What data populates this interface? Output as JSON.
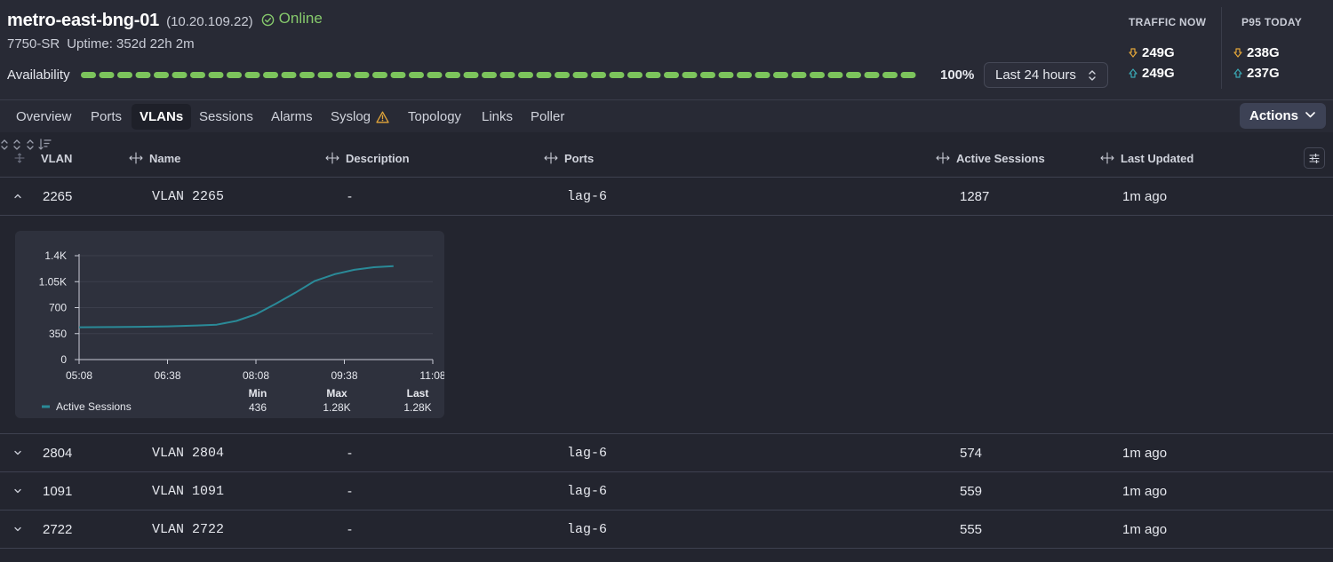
{
  "device": {
    "name": "metro-east-bng-01",
    "ip": "(10.20.109.22)",
    "status": "Online",
    "status_color": "#86c96c",
    "model": "7750-SR",
    "uptime": "Uptime: 352d 22h 2m",
    "availability_label": "Availability",
    "availability_pct": "100%",
    "availability_value": 1.0,
    "availability_color": "#7cc45c",
    "time_range": "Last 24 hours"
  },
  "traffic_now": {
    "label": "TRAFFIC NOW",
    "in": "249G",
    "out": "249G"
  },
  "p95_today": {
    "label": "P95 TODAY",
    "in": "238G",
    "out": "237G"
  },
  "colors": {
    "in_arrow": "#e3a63a",
    "out_arrow": "#3aa8b4",
    "warning": "#e3a63a",
    "series": "#2a8a98"
  },
  "tabs": [
    {
      "label": "Overview",
      "active": false
    },
    {
      "label": "Ports",
      "active": false
    },
    {
      "label": "VLANs",
      "active": true
    },
    {
      "label": "Sessions",
      "active": false
    },
    {
      "label": "Alarms",
      "active": false
    },
    {
      "label": "Syslog",
      "active": false,
      "icon": "warning-icon"
    },
    {
      "label": "Topology",
      "active": false
    },
    {
      "label": "Links",
      "active": false
    },
    {
      "label": "Poller",
      "active": false
    }
  ],
  "actions_label": "Actions",
  "table": {
    "columns": [
      "VLAN",
      "Name",
      "Description",
      "Ports",
      "Active Sessions",
      "Last Updated"
    ],
    "sorted_column": "Active Sessions",
    "sort_direction": "descending",
    "rows": [
      {
        "vlan": "2265",
        "name": "VLAN 2265",
        "description": "-",
        "ports": "lag-6",
        "active_sessions": "1287",
        "last_updated": "1m ago",
        "expanded": true
      },
      {
        "vlan": "2804",
        "name": "VLAN 2804",
        "description": "-",
        "ports": "lag-6",
        "active_sessions": "574",
        "last_updated": "1m ago",
        "expanded": false
      },
      {
        "vlan": "1091",
        "name": "VLAN 1091",
        "description": "-",
        "ports": "lag-6",
        "active_sessions": "559",
        "last_updated": "1m ago",
        "expanded": false
      },
      {
        "vlan": "2722",
        "name": "VLAN 2722",
        "description": "-",
        "ports": "lag-6",
        "active_sessions": "555",
        "last_updated": "1m ago",
        "expanded": false
      }
    ]
  },
  "chart_data": {
    "type": "line",
    "title": "",
    "xlabel": "",
    "ylabel": "",
    "x_ticks": [
      "05:08",
      "06:38",
      "08:08",
      "09:38",
      "11:08"
    ],
    "y_ticks": [
      "0",
      "350",
      "700",
      "1.05K",
      "1.4K"
    ],
    "ylim": [
      0,
      1400
    ],
    "xlim": [
      "05:08",
      "11:08"
    ],
    "grid": true,
    "legend": "bottom-left",
    "series": [
      {
        "name": "Active Sessions",
        "x": [
          "05:08",
          "05:38",
          "06:08",
          "06:38",
          "07:08",
          "07:28",
          "07:48",
          "08:08",
          "08:28",
          "08:48",
          "09:08",
          "09:28",
          "09:48",
          "10:08",
          "10:28"
        ],
        "values": [
          436,
          438,
          442,
          448,
          460,
          470,
          520,
          610,
          750,
          900,
          1060,
          1150,
          1210,
          1245,
          1260
        ]
      }
    ],
    "stats": [
      {
        "label": "Min",
        "value": "436"
      },
      {
        "label": "Max",
        "value": "1.28K"
      },
      {
        "label": "Last",
        "value": "1.28K"
      }
    ]
  }
}
